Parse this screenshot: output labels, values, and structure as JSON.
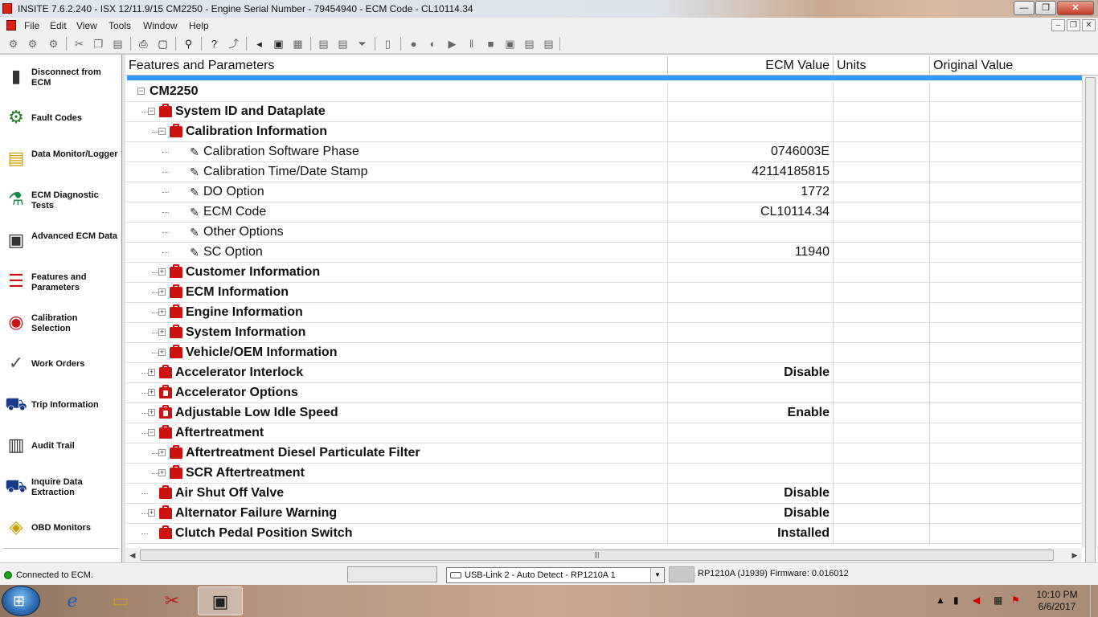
{
  "window": {
    "title": "INSITE 7.6.2.240  -  ISX 12/11.9/15 CM2250 - Engine Serial Number - 79454940 - ECM Code - CL10114.34",
    "minimize": "—",
    "maximize": "❐",
    "close": "✕"
  },
  "menu": {
    "items": [
      "File",
      "Edit",
      "View",
      "Tools",
      "Window",
      "Help"
    ]
  },
  "mdi": {
    "minimize": "–",
    "restore": "❐",
    "close": "✕"
  },
  "sidebar": {
    "items": [
      {
        "label": "Disconnect from ECM",
        "icon": "disconnect-icon"
      },
      {
        "label": "Fault Codes",
        "icon": "fault-codes-icon"
      },
      {
        "label": "Data Monitor/Logger",
        "icon": "data-monitor-icon"
      },
      {
        "label": "ECM Diagnostic Tests",
        "icon": "diagnostic-flask-icon"
      },
      {
        "label": "Advanced ECM Data",
        "icon": "advanced-ecm-icon"
      },
      {
        "label": "Features and Parameters",
        "icon": "features-parameters-icon"
      },
      {
        "label": "Calibration Selection",
        "icon": "calibration-disc-icon"
      },
      {
        "label": "Work Orders",
        "icon": "work-orders-icon"
      },
      {
        "label": "Trip Information",
        "icon": "truck-icon"
      },
      {
        "label": "Audit Trail",
        "icon": "audit-trail-icon"
      },
      {
        "label": "Inquire Data Extraction",
        "icon": "data-extraction-icon"
      },
      {
        "label": "OBD Monitors",
        "icon": "obd-monitors-icon"
      }
    ]
  },
  "grid": {
    "columns": [
      "Features and Parameters",
      "ECM Value",
      "Units",
      "Original Value"
    ],
    "rows": [
      {
        "label": "CM2250",
        "value": "",
        "level": 0,
        "kind": "root",
        "expand": "minus"
      },
      {
        "label": "System ID and Dataplate",
        "value": "",
        "level": 1,
        "kind": "folder",
        "expand": "minus"
      },
      {
        "label": "Calibration Information",
        "value": "",
        "level": 2,
        "kind": "folder",
        "expand": "minus"
      },
      {
        "label": "Calibration Software Phase",
        "value": "0746003E",
        "level": 3,
        "kind": "param"
      },
      {
        "label": "Calibration Time/Date Stamp",
        "value": "42114185815",
        "level": 3,
        "kind": "param"
      },
      {
        "label": "DO Option",
        "value": "1772",
        "level": 3,
        "kind": "param"
      },
      {
        "label": "ECM Code",
        "value": "CL10114.34",
        "level": 3,
        "kind": "param"
      },
      {
        "label": "Other Options",
        "value": "",
        "level": 3,
        "kind": "param"
      },
      {
        "label": "SC Option",
        "value": "11940",
        "level": 3,
        "kind": "param"
      },
      {
        "label": "Customer Information",
        "value": "",
        "level": 2,
        "kind": "folder",
        "expand": "plus"
      },
      {
        "label": "ECM Information",
        "value": "",
        "level": 2,
        "kind": "folder",
        "expand": "plus"
      },
      {
        "label": "Engine Information",
        "value": "",
        "level": 2,
        "kind": "folder",
        "expand": "plus"
      },
      {
        "label": "System Information",
        "value": "",
        "level": 2,
        "kind": "folder",
        "expand": "plus"
      },
      {
        "label": "Vehicle/OEM Information",
        "value": "",
        "level": 2,
        "kind": "folder",
        "expand": "plus"
      },
      {
        "label": "Accelerator Interlock",
        "value": "Disable",
        "level": 1,
        "kind": "folder",
        "expand": "plus"
      },
      {
        "label": "Accelerator Options",
        "value": "",
        "level": 1,
        "kind": "folder-lock",
        "expand": "plus"
      },
      {
        "label": "Adjustable Low Idle Speed",
        "value": "Enable",
        "level": 1,
        "kind": "folder-lock",
        "expand": "plus"
      },
      {
        "label": "Aftertreatment",
        "value": "",
        "level": 1,
        "kind": "folder",
        "expand": "minus"
      },
      {
        "label": "Aftertreatment Diesel Particulate Filter",
        "value": "",
        "level": 2,
        "kind": "folder",
        "expand": "plus"
      },
      {
        "label": "SCR Aftertreatment",
        "value": "",
        "level": 2,
        "kind": "folder",
        "expand": "plus"
      },
      {
        "label": "Air Shut Off Valve",
        "value": "Disable",
        "level": 1,
        "kind": "folder",
        "expand": "none"
      },
      {
        "label": "Alternator Failure Warning",
        "value": "Disable",
        "level": 1,
        "kind": "folder",
        "expand": "plus"
      },
      {
        "label": "Clutch Pedal Position Switch",
        "value": "Installed",
        "level": 1,
        "kind": "folder",
        "expand": "none"
      }
    ]
  },
  "status": {
    "connection": "Connected to ECM.",
    "adapter": "USB-Link 2 - Auto Detect - RP1210A 1",
    "protocol_firmware": "RP1210A (J1939)  Firmware: 0.016012",
    "connection_color": "#1aa11a"
  },
  "taskbar": {
    "time": "10:10 PM",
    "date": "6/6/2017",
    "apps": [
      "internet-explorer-icon",
      "file-explorer-icon",
      "snipping-tool-icon",
      "insite-icon"
    ]
  },
  "colors": {
    "selection": "#3399ff",
    "folder": "#cc1111"
  }
}
